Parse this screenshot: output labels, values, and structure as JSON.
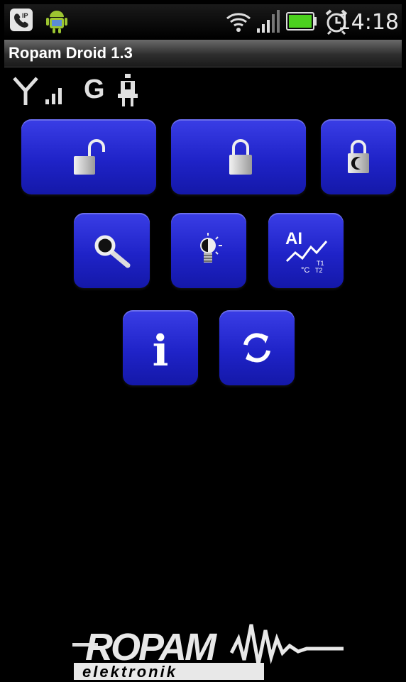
{
  "status_bar": {
    "time": "14:18",
    "icons": [
      "ip-phone-icon",
      "android-icon",
      "wifi-icon",
      "cell-signal-icon",
      "battery-icon",
      "alarm-clock-icon"
    ]
  },
  "app": {
    "title": "Ropam Droid 1.3"
  },
  "indicators": {
    "network_type": "G",
    "icons": [
      "antenna-icon",
      "signal-bars-icon",
      "plug-icon"
    ]
  },
  "buttons": [
    {
      "name": "disarm-button",
      "icon": "unlocked-padlock-icon"
    },
    {
      "name": "arm-button",
      "icon": "locked-padlock-icon"
    },
    {
      "name": "night-arm-button",
      "icon": "padlock-moon-icon"
    },
    {
      "name": "search-button",
      "icon": "magnifier-icon"
    },
    {
      "name": "outputs-button",
      "icon": "light-bulb-icon"
    },
    {
      "name": "analog-inputs-button",
      "icon": "ai-chart-icon",
      "label_ai": "AI",
      "label_c": "°C",
      "label_t1": "T1",
      "label_t2": "T2"
    },
    {
      "name": "info-button",
      "icon": "info-icon",
      "label": "i"
    },
    {
      "name": "refresh-button",
      "icon": "refresh-icon"
    }
  ],
  "logo": {
    "brand": "ROPAM",
    "sub": "elektronik"
  },
  "colors": {
    "button": "#2327d2",
    "background": "#000000"
  }
}
